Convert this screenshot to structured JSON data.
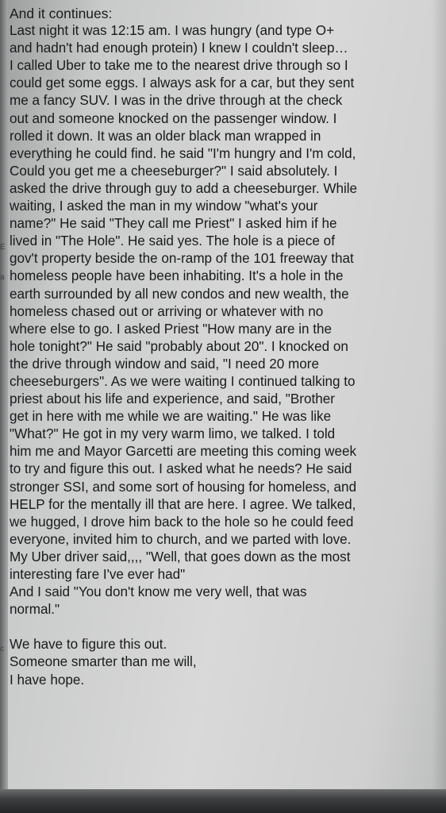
{
  "screen": {
    "edge_marks": [
      "a",
      "E",
      "c"
    ],
    "note": {
      "lines": [
        "And it continues:",
        "Last night it was 12:15 am. I was hungry (and type O+",
        "and hadn't had enough protein) I knew I couldn't sleep…",
        "I called Uber to take me to the nearest drive through so I",
        "could get some eggs. I always ask for a car, but they sent",
        "me a fancy SUV. I was in the drive through at the check",
        "out and someone knocked on the passenger window. I",
        "rolled it down. It was an older black man wrapped in",
        "everything he could find. he said \"I'm hungry and I'm cold,",
        "Could you get me a cheeseburger?\" I said absolutely. I",
        "asked the drive through guy to add a cheeseburger. While",
        "waiting, I asked the man in my window \"what's your",
        "name?\" He said \"They call me Priest\" I asked him if he",
        "lived in \"The Hole\". He said yes. The hole is a piece of",
        "gov't property beside the on-ramp of the 101 freeway that",
        "homeless people have been inhabiting. It's a hole in the",
        "earth surrounded by all new condos and new wealth, the",
        "homeless chased out or arriving or whatever with no",
        "where else to go. I asked Priest \"How many are in the",
        "hole tonight?\" He said \"probably about 20\". I knocked on",
        "the drive through window and said, \"I need 20 more",
        "cheeseburgers\". As we were waiting I continued talking to",
        "priest about his life and experience, and said, \"Brother",
        "get in here with me while we are waiting.\" He was like",
        "\"What?\" He got in my very warm limo, we talked. I told",
        "him me and Mayor Garcetti are meeting this coming week",
        "to try and figure this out. I asked what he needs? He said",
        "stronger SSI, and some sort of housing for homeless, and",
        "HELP for the mentally ill that are here. I agree. We talked,",
        "we hugged, I drove him back to the hole so he could feed",
        "everyone, invited him to church, and we parted with love.",
        "My Uber driver said,,,, \"Well, that goes down as the most",
        "interesting fare I've ever had\"",
        "And I said \"You don't know me very well, that was",
        "normal.\"",
        "",
        "We have to figure this out.",
        "Someone smarter than me will,",
        "I have hope."
      ]
    }
  }
}
